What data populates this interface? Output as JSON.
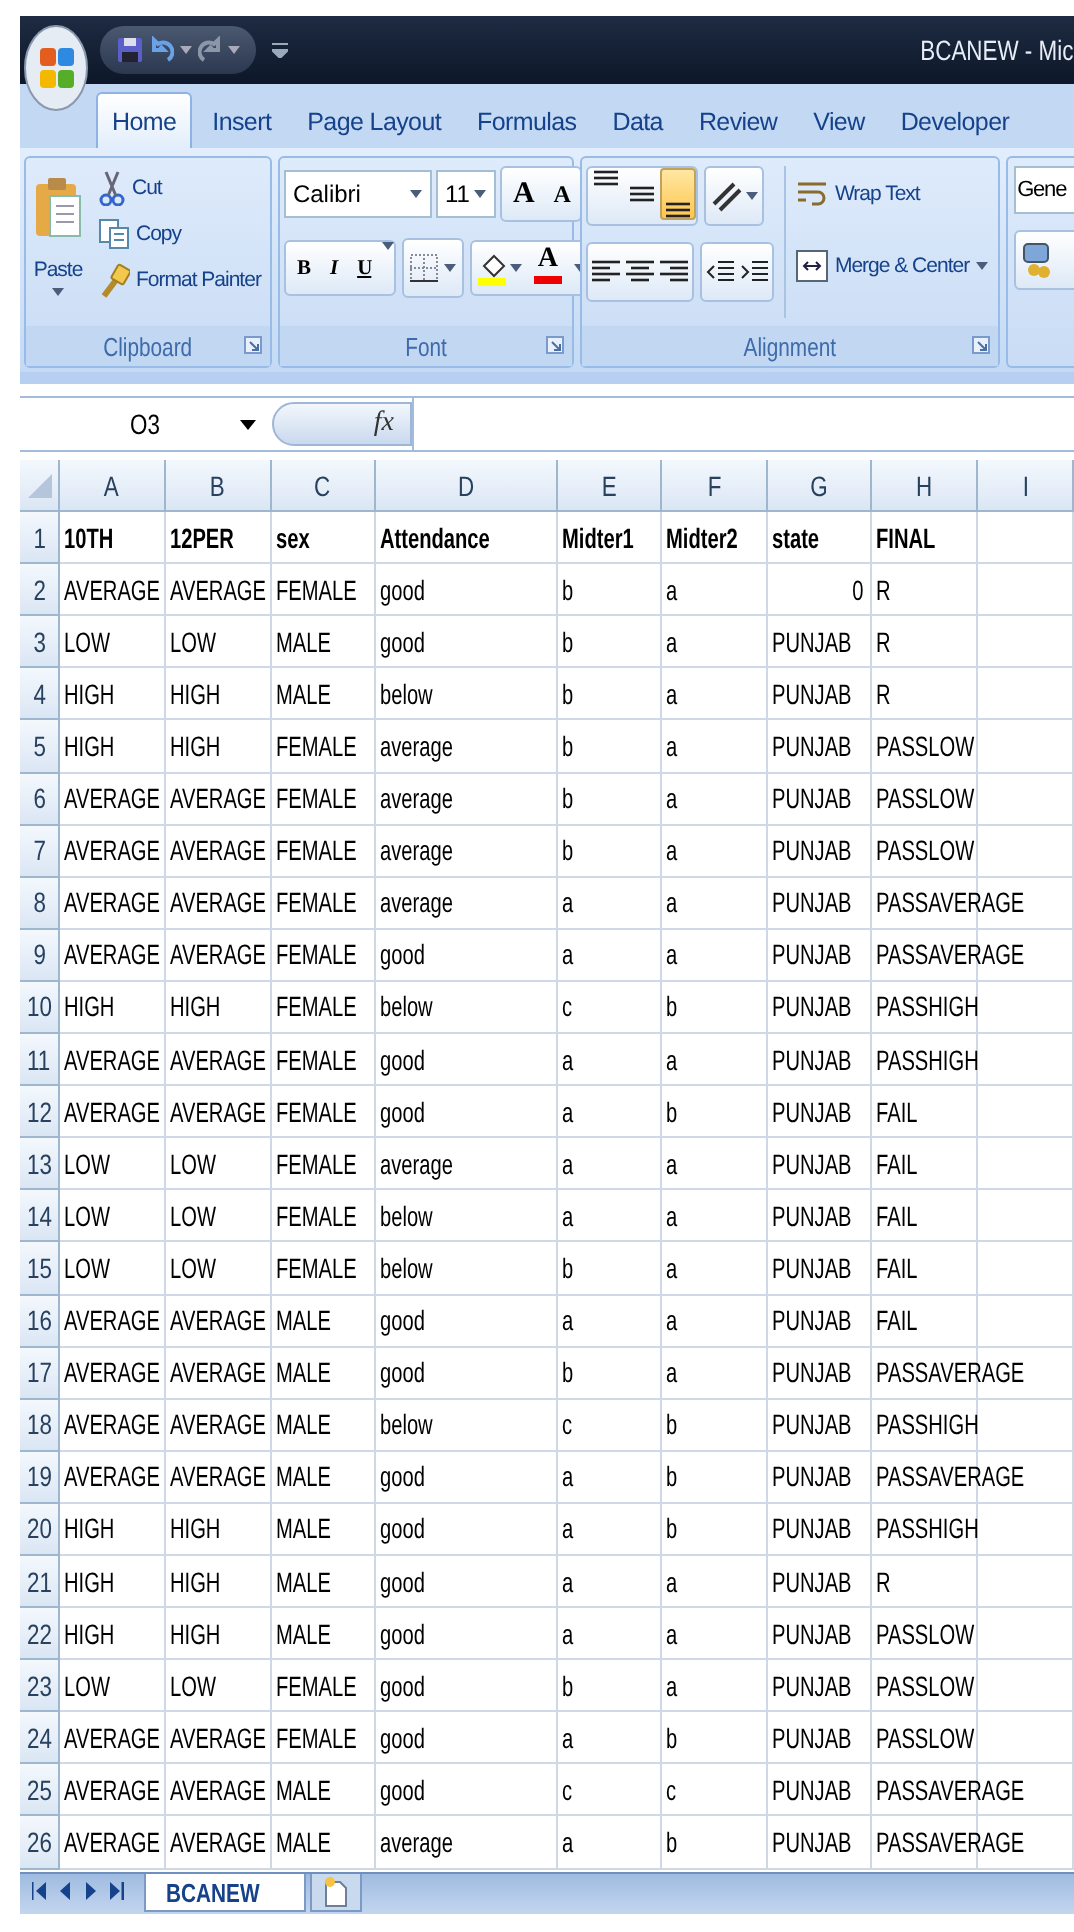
{
  "title_bar": {
    "title": "BCANEW - Mic"
  },
  "ribbon_tabs": [
    {
      "label": "Home",
      "selected": true
    },
    {
      "label": "Insert",
      "selected": false
    },
    {
      "label": "Page Layout",
      "selected": false
    },
    {
      "label": "Formulas",
      "selected": false
    },
    {
      "label": "Data",
      "selected": false
    },
    {
      "label": "Review",
      "selected": false
    },
    {
      "label": "View",
      "selected": false
    },
    {
      "label": "Developer",
      "selected": false
    }
  ],
  "ribbon": {
    "clipboard": {
      "label": "Clipboard",
      "paste": "Paste",
      "cut": "Cut",
      "copy": "Copy",
      "format_painter": "Format Painter"
    },
    "font": {
      "label": "Font",
      "font_name": "Calibri",
      "font_size": "11",
      "grow": "A",
      "shrink": "A",
      "bold": "B",
      "italic": "I",
      "underline": "U",
      "font_color": "A"
    },
    "alignment": {
      "label": "Alignment",
      "vertical": [
        {
          "kind": "top",
          "selected": false
        },
        {
          "kind": "middle",
          "selected": false
        },
        {
          "kind": "bottom",
          "selected": true
        }
      ],
      "wrap_text": "Wrap Text",
      "merge_center": "Merge & Center"
    },
    "number": {
      "format": "Gene"
    }
  },
  "formula_bar": {
    "name_box": "O3",
    "function_label": "fx"
  },
  "sheet": {
    "columns": [
      "A",
      "B",
      "C",
      "D",
      "E",
      "F",
      "G",
      "H",
      "I"
    ],
    "header_row": {
      "number": "1",
      "cells": [
        "10TH",
        "12PER",
        "sex",
        "Attendance",
        "Midter1",
        "Midter2",
        "state",
        "FINAL"
      ]
    },
    "rows": [
      {
        "number": "2",
        "cells": [
          "AVERAGE",
          "AVERAGE",
          "FEMALE",
          "good",
          "b",
          "a",
          {
            "text": "0",
            "kind": "number"
          },
          "R"
        ]
      },
      {
        "number": "3",
        "cells": [
          "LOW",
          "LOW",
          "MALE",
          "good",
          "b",
          "a",
          "PUNJAB",
          "R"
        ]
      },
      {
        "number": "4",
        "cells": [
          "HIGH",
          "HIGH",
          "MALE",
          "below",
          "b",
          "a",
          "PUNJAB",
          "R"
        ]
      },
      {
        "number": "5",
        "cells": [
          "HIGH",
          "HIGH",
          "FEMALE",
          "average",
          "b",
          "a",
          "PUNJAB",
          "PASSLOW"
        ]
      },
      {
        "number": "6",
        "cells": [
          "AVERAGE",
          "AVERAGE",
          "FEMALE",
          "average",
          "b",
          "a",
          "PUNJAB",
          "PASSLOW"
        ]
      },
      {
        "number": "7",
        "cells": [
          "AVERAGE",
          "AVERAGE",
          "FEMALE",
          "average",
          "b",
          "a",
          "PUNJAB",
          "PASSLOW"
        ]
      },
      {
        "number": "8",
        "cells": [
          "AVERAGE",
          "AVERAGE",
          "FEMALE",
          "average",
          "a",
          "a",
          "PUNJAB",
          "PASSAVERAGE"
        ]
      },
      {
        "number": "9",
        "cells": [
          "AVERAGE",
          "AVERAGE",
          "FEMALE",
          "good",
          "a",
          "a",
          "PUNJAB",
          "PASSAVERAGE"
        ]
      },
      {
        "number": "10",
        "cells": [
          "HIGH",
          "HIGH",
          "FEMALE",
          "below",
          "c",
          "b",
          "PUNJAB",
          "PASSHIGH"
        ]
      },
      {
        "number": "11",
        "cells": [
          "AVERAGE",
          "AVERAGE",
          "FEMALE",
          "good",
          "a",
          "a",
          "PUNJAB",
          "PASSHIGH"
        ]
      },
      {
        "number": "12",
        "cells": [
          "AVERAGE",
          "AVERAGE",
          "FEMALE",
          "good",
          "a",
          "b",
          "PUNJAB",
          "FAIL"
        ]
      },
      {
        "number": "13",
        "cells": [
          "LOW",
          "LOW",
          "FEMALE",
          "average",
          "a",
          "a",
          "PUNJAB",
          "FAIL"
        ]
      },
      {
        "number": "14",
        "cells": [
          "LOW",
          "LOW",
          "FEMALE",
          "below",
          "a",
          "a",
          "PUNJAB",
          "FAIL"
        ]
      },
      {
        "number": "15",
        "cells": [
          "LOW",
          "LOW",
          "FEMALE",
          "below",
          "b",
          "a",
          "PUNJAB",
          "FAIL"
        ]
      },
      {
        "number": "16",
        "cells": [
          "AVERAGE",
          "AVERAGE",
          "MALE",
          "good",
          "a",
          "a",
          "PUNJAB",
          "FAIL"
        ]
      },
      {
        "number": "17",
        "cells": [
          "AVERAGE",
          "AVERAGE",
          "MALE",
          "good",
          "b",
          "a",
          "PUNJAB",
          "PASSAVERAGE"
        ]
      },
      {
        "number": "18",
        "cells": [
          "AVERAGE",
          "AVERAGE",
          "MALE",
          "below",
          "c",
          "b",
          "PUNJAB",
          "PASSHIGH"
        ]
      },
      {
        "number": "19",
        "cells": [
          "AVERAGE",
          "AVERAGE",
          "MALE",
          "good",
          "a",
          "b",
          "PUNJAB",
          "PASSAVERAGE"
        ]
      },
      {
        "number": "20",
        "cells": [
          "HIGH",
          "HIGH",
          "MALE",
          "good",
          "a",
          "b",
          "PUNJAB",
          "PASSHIGH"
        ]
      },
      {
        "number": "21",
        "cells": [
          "HIGH",
          "HIGH",
          "MALE",
          "good",
          "a",
          "a",
          "PUNJAB",
          "R"
        ]
      },
      {
        "number": "22",
        "cells": [
          "HIGH",
          "HIGH",
          "MALE",
          "good",
          "a",
          "a",
          "PUNJAB",
          "PASSLOW"
        ]
      },
      {
        "number": "23",
        "cells": [
          "LOW",
          "LOW",
          "FEMALE",
          "good",
          "b",
          "a",
          "PUNJAB",
          "PASSLOW"
        ]
      },
      {
        "number": "24",
        "cells": [
          "AVERAGE",
          "AVERAGE",
          "FEMALE",
          "good",
          "a",
          "b",
          "PUNJAB",
          "PASSLOW"
        ]
      },
      {
        "number": "25",
        "cells": [
          "AVERAGE",
          "AVERAGE",
          "MALE",
          "good",
          "c",
          "c",
          "PUNJAB",
          "PASSAVERAGE"
        ]
      },
      {
        "number": "26",
        "cells": [
          "AVERAGE",
          "AVERAGE",
          "MALE",
          "average",
          "a",
          "b",
          "PUNJAB",
          "PASSAVERAGE"
        ]
      }
    ]
  },
  "sheet_tabs": [
    {
      "label": "BCANEW",
      "selected": true
    }
  ]
}
